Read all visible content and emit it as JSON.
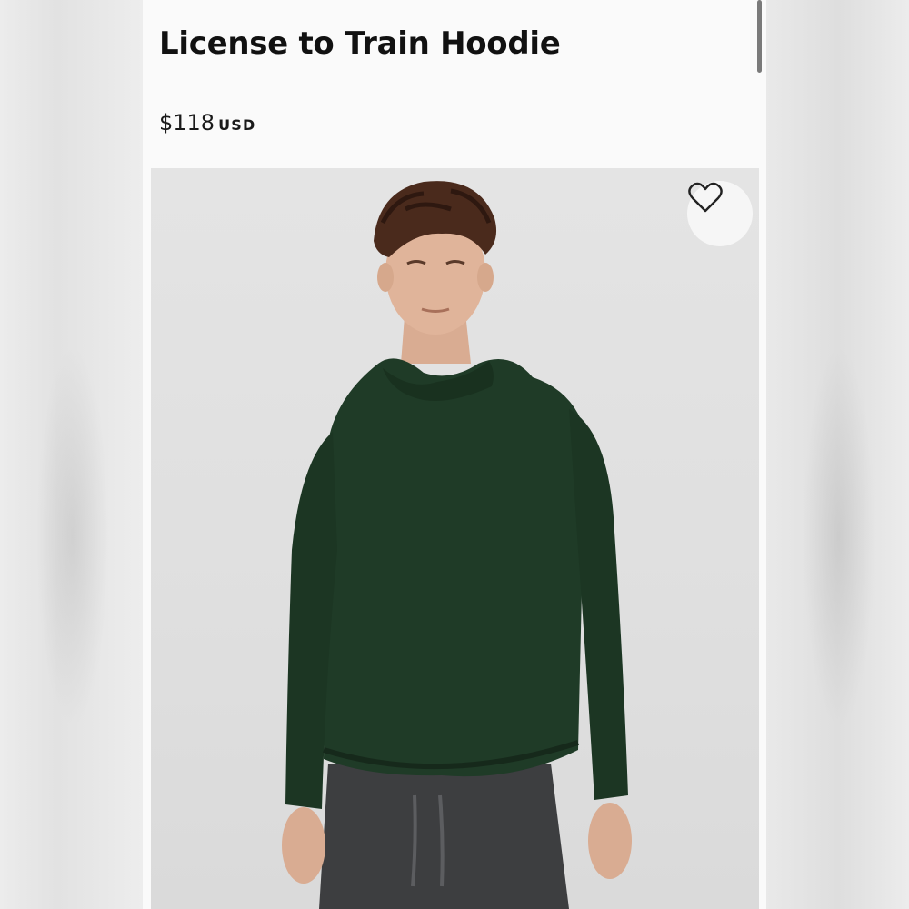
{
  "product": {
    "title": "License to Train Hoodie",
    "price": "$118",
    "currency": "USD"
  },
  "icons": {
    "favorite": "heart-outline-icon"
  },
  "colors": {
    "hoodie": "#1f3b27",
    "pants": "#3d3e40",
    "background": "#e0e0e0"
  }
}
